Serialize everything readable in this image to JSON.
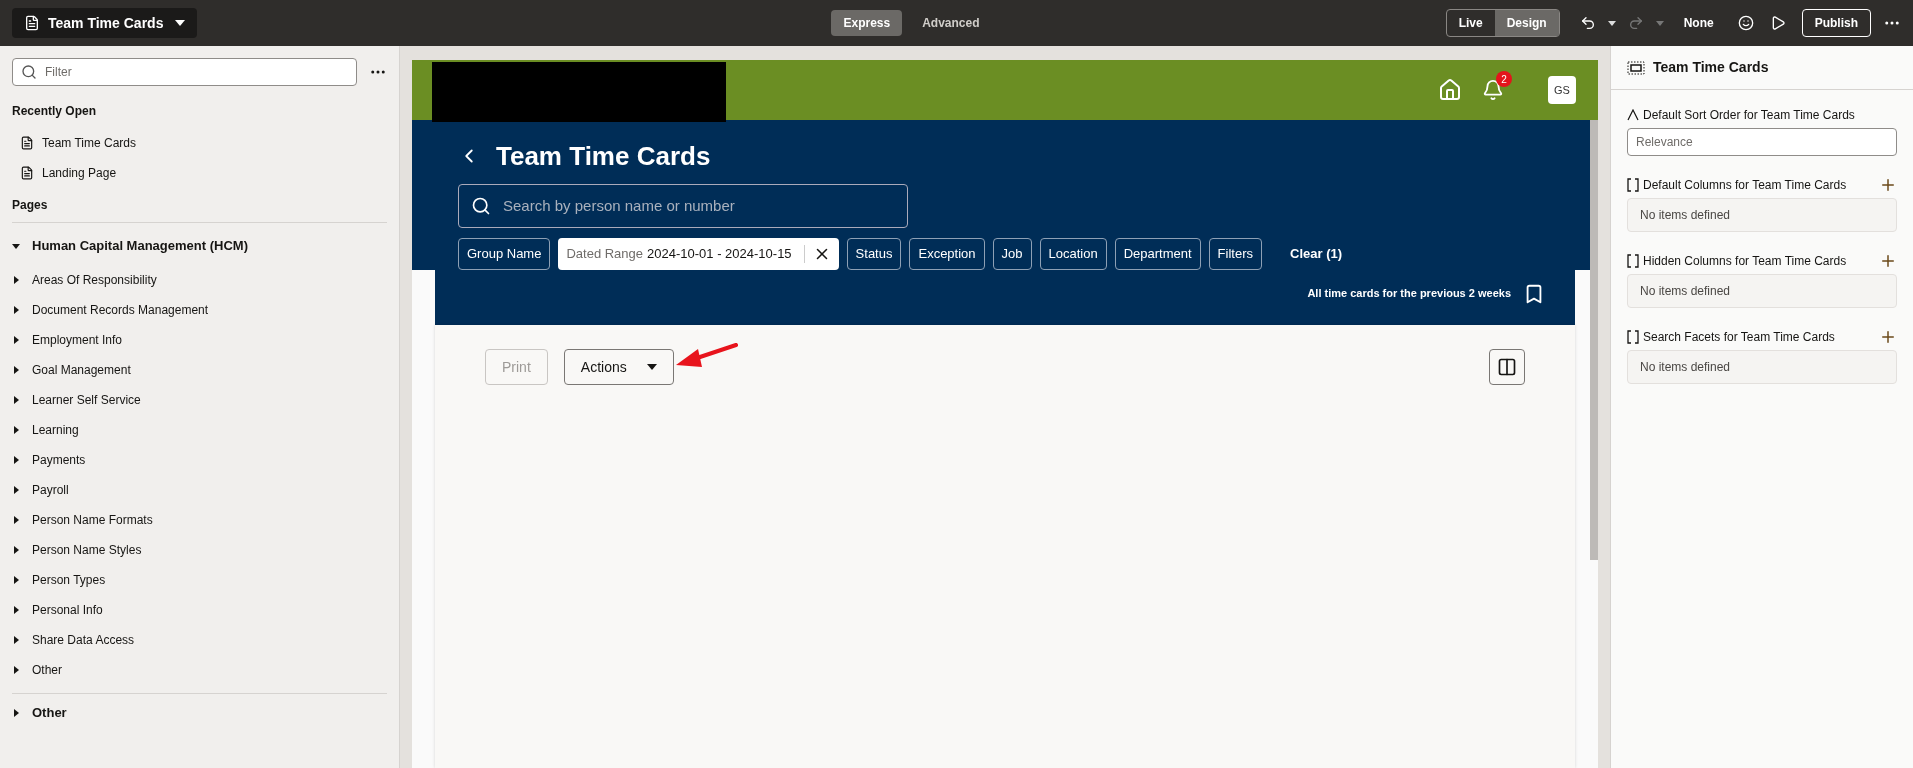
{
  "topbar": {
    "title": "Team Time Cards",
    "modes": [
      {
        "label": "Express",
        "selected": true
      },
      {
        "label": "Advanced",
        "selected": false
      }
    ],
    "views": [
      {
        "label": "Live",
        "selected": false
      },
      {
        "label": "Design",
        "selected": true
      }
    ],
    "translation": "None",
    "publish": "Publish"
  },
  "sidebar": {
    "filter_placeholder": "Filter",
    "recent_heading": "Recently Open",
    "recent": [
      "Team Time Cards",
      "Landing Page"
    ],
    "pages_heading": "Pages",
    "tree": [
      {
        "label": "Human Capital Management (HCM)",
        "expanded": true,
        "children": [
          {
            "label": "Areas Of Responsibility",
            "expanded": false
          },
          {
            "label": "Document Records Management",
            "expanded": false
          },
          {
            "label": "Employment Info",
            "expanded": false
          },
          {
            "label": "Goal Management",
            "expanded": false
          },
          {
            "label": "Learner Self Service",
            "expanded": false
          },
          {
            "label": "Learning",
            "expanded": false
          },
          {
            "label": "Payments",
            "expanded": false
          },
          {
            "label": "Payroll",
            "expanded": false
          },
          {
            "label": "Person Name Formats",
            "expanded": false
          },
          {
            "label": "Person Name Styles",
            "expanded": false
          },
          {
            "label": "Person Types",
            "expanded": false
          },
          {
            "label": "Personal Info",
            "expanded": false
          },
          {
            "label": "Share Data Access",
            "expanded": false
          },
          {
            "label": "Other",
            "expanded": false
          }
        ]
      },
      {
        "label": "Other",
        "expanded": false
      }
    ]
  },
  "preview": {
    "notification_count": "2",
    "avatar": "GS",
    "page_title": "Team Time Cards",
    "search_placeholder": "Search by person name or number",
    "filters": [
      {
        "kind": "chip",
        "label": "Group Name"
      },
      {
        "kind": "range",
        "label": "Dated Range",
        "value": "2024-10-01 - 2024-10-15"
      },
      {
        "kind": "chip",
        "label": "Status"
      },
      {
        "kind": "chip",
        "label": "Exception"
      },
      {
        "kind": "chip",
        "label": "Job"
      },
      {
        "kind": "chip",
        "label": "Location"
      },
      {
        "kind": "chip",
        "label": "Department"
      },
      {
        "kind": "chip",
        "label": "Filters"
      }
    ],
    "clear": "Clear (1)",
    "saved_search": "All time cards for the previous 2 weeks",
    "buttons": [
      {
        "label": "Print",
        "disabled": true
      },
      {
        "label": "Actions",
        "disabled": false
      }
    ]
  },
  "properties": {
    "title": "Team Time Cards",
    "sort_label": "Default Sort Order for Team Time Cards",
    "sort_field": {
      "placeholder": "Relevance"
    },
    "sections": [
      {
        "label": "Default Columns for Team Time Cards",
        "empty": "No items defined"
      },
      {
        "label": "Hidden Columns for Team Time Cards",
        "empty": "No items defined"
      },
      {
        "label": "Search Facets for Team Time Cards",
        "empty": "No items defined"
      }
    ]
  }
}
